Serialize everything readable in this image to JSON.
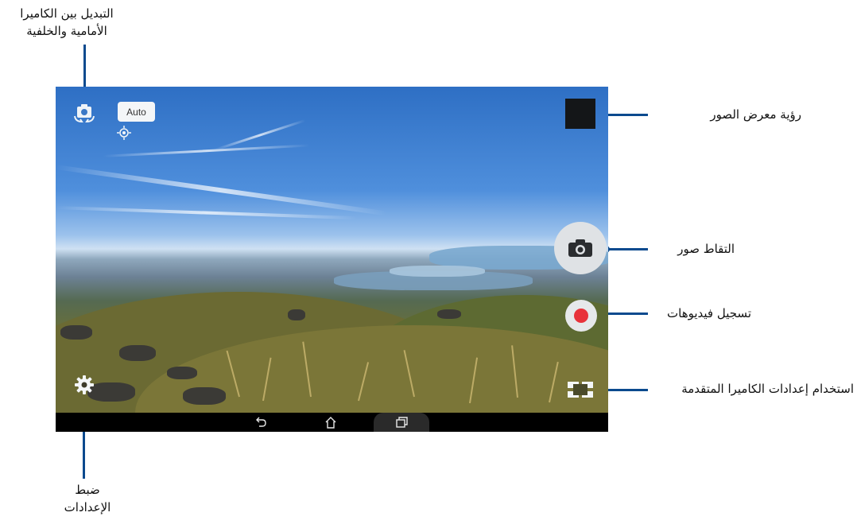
{
  "callouts": {
    "switch_camera": [
      "التبديل بين الكاميرا",
      "الأمامية والخلفية"
    ],
    "gallery": "رؤية معرض الصور",
    "capture": "التقاط صور",
    "record": "تسجيل فيديوهات",
    "advanced": "استخدام إعدادات الكاميرا المتقدمة",
    "settings": [
      "ضبط",
      "الإعدادات"
    ]
  },
  "camera": {
    "mode_badge": "Auto",
    "icons": {
      "switch": "switch-camera-icon",
      "focus": "focus-target-icon",
      "shutter": "camera-icon",
      "record": "record-dot-icon",
      "settings": "gear-icon",
      "advanced": "advanced-settings-icon",
      "back": "back-icon",
      "home": "home-icon",
      "recents": "recents-icon"
    }
  },
  "colors": {
    "callout_line": "#0b4a8e",
    "record_red": "#e8323a"
  }
}
